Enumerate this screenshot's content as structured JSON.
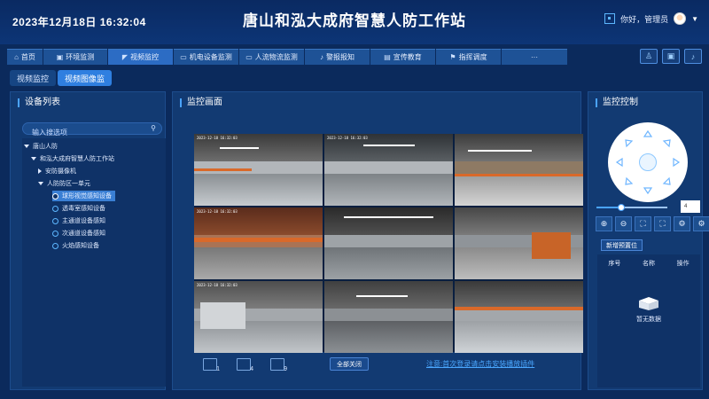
{
  "header": {
    "datetime": "2023年12月18日  16:32:04",
    "title": "唐山和泓大成府智慧人防工作站",
    "greeting": "你好，管理员"
  },
  "nav": {
    "items": [
      {
        "label": "首页",
        "icon": "home-icon"
      },
      {
        "label": "环境监测",
        "icon": "monitor-icon"
      },
      {
        "label": "视频监控",
        "icon": "camera-icon",
        "active": true
      },
      {
        "label": "机电设备监测",
        "icon": "screen-icon"
      },
      {
        "label": "人流物流监测",
        "icon": "screen-icon"
      },
      {
        "label": "警报报知",
        "icon": "bell-icon"
      },
      {
        "label": "宣传教育",
        "icon": "book-icon"
      },
      {
        "label": "指挥调度",
        "icon": "flag-icon"
      },
      {
        "label": "···",
        "icon": ""
      }
    ]
  },
  "subtabs": [
    "视频监控",
    "视频图像监"
  ],
  "device_list": {
    "title": "设备列表",
    "search_placeholder": "输入搜选项",
    "tree": [
      {
        "label": "唐山人防",
        "level": 0,
        "expand": "down"
      },
      {
        "label": "和泓大成府智慧人防工作站",
        "level": 1,
        "expand": "down"
      },
      {
        "label": "安防摄像机",
        "level": 2,
        "expand": "right"
      },
      {
        "label": "人防防区一单元",
        "level": 2,
        "expand": "down"
      },
      {
        "label": "球形视觉感知设备",
        "level": 3,
        "device": true,
        "selected": true
      },
      {
        "label": "透毒室感知设备",
        "level": 3,
        "device": true
      },
      {
        "label": "主通道设备感知",
        "level": 3,
        "device": true
      },
      {
        "label": "次通道设备感知",
        "level": 3,
        "device": true
      },
      {
        "label": "火焰感知设备",
        "level": 3,
        "device": true
      }
    ]
  },
  "monitor": {
    "title": "监控画面",
    "close_all": "全部关闭",
    "plugin_notice": "注意:首次登录请点击安装播放插件",
    "layout_buttons": [
      "1",
      "4",
      "9"
    ],
    "cameras": [
      {
        "timestamp": "2023-12-18 16:32:03"
      },
      {
        "timestamp": "2023-12-18 16:32:03"
      },
      {
        "timestamp": ""
      },
      {
        "timestamp": "2023-12-18 16:32:03"
      },
      {
        "timestamp": ""
      },
      {
        "timestamp": ""
      },
      {
        "timestamp": "2023-12-18 16:32:03"
      },
      {
        "timestamp": ""
      },
      {
        "timestamp": ""
      }
    ]
  },
  "ptz": {
    "title": "监控控制",
    "zoom_value": "4",
    "zoom_level": 0.35,
    "controls": [
      "zoom-in",
      "zoom-out",
      "focus-near",
      "focus-far",
      "iris-open",
      "iris-close"
    ],
    "preset_button": "新增预置位",
    "table_headers": [
      "序号",
      "名称",
      "操作"
    ],
    "empty_text": "暂无数据"
  }
}
